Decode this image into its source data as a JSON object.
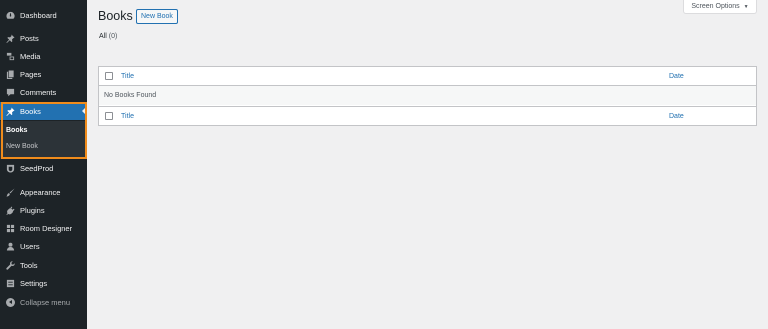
{
  "sidebar": {
    "items": [
      {
        "label": "Dashboard",
        "icon": "dashboard-icon"
      },
      {
        "label": "Posts",
        "icon": "pin-icon"
      },
      {
        "label": "Media",
        "icon": "media-icon"
      },
      {
        "label": "Pages",
        "icon": "pages-icon"
      },
      {
        "label": "Comments",
        "icon": "comment-icon"
      },
      {
        "label": "Books",
        "icon": "pin-icon",
        "active": true
      },
      {
        "label": "SeedProd",
        "icon": "seedprod-icon"
      },
      {
        "label": "Appearance",
        "icon": "brush-icon"
      },
      {
        "label": "Plugins",
        "icon": "plugin-icon"
      },
      {
        "label": "Room Designer",
        "icon": "grid-icon"
      },
      {
        "label": "Users",
        "icon": "user-icon"
      },
      {
        "label": "Tools",
        "icon": "wrench-icon"
      },
      {
        "label": "Settings",
        "icon": "settings-icon"
      }
    ],
    "submenu": [
      {
        "label": "Books",
        "current": true
      },
      {
        "label": "New Book"
      }
    ],
    "collapse_label": "Collapse menu",
    "highlight_color": "#f08c1c"
  },
  "header": {
    "title": "Books",
    "new_button": "New Book",
    "screen_options": "Screen Options",
    "screen_options_caret": "▼"
  },
  "filter": {
    "all_label": "All",
    "all_count": "(0)"
  },
  "table": {
    "columns": [
      "Title",
      "Date"
    ],
    "empty_message": "No Books Found"
  },
  "colors": {
    "sidebar_bg": "#1d2327",
    "accent": "#2271b1",
    "page_bg": "#f0f0f1"
  }
}
